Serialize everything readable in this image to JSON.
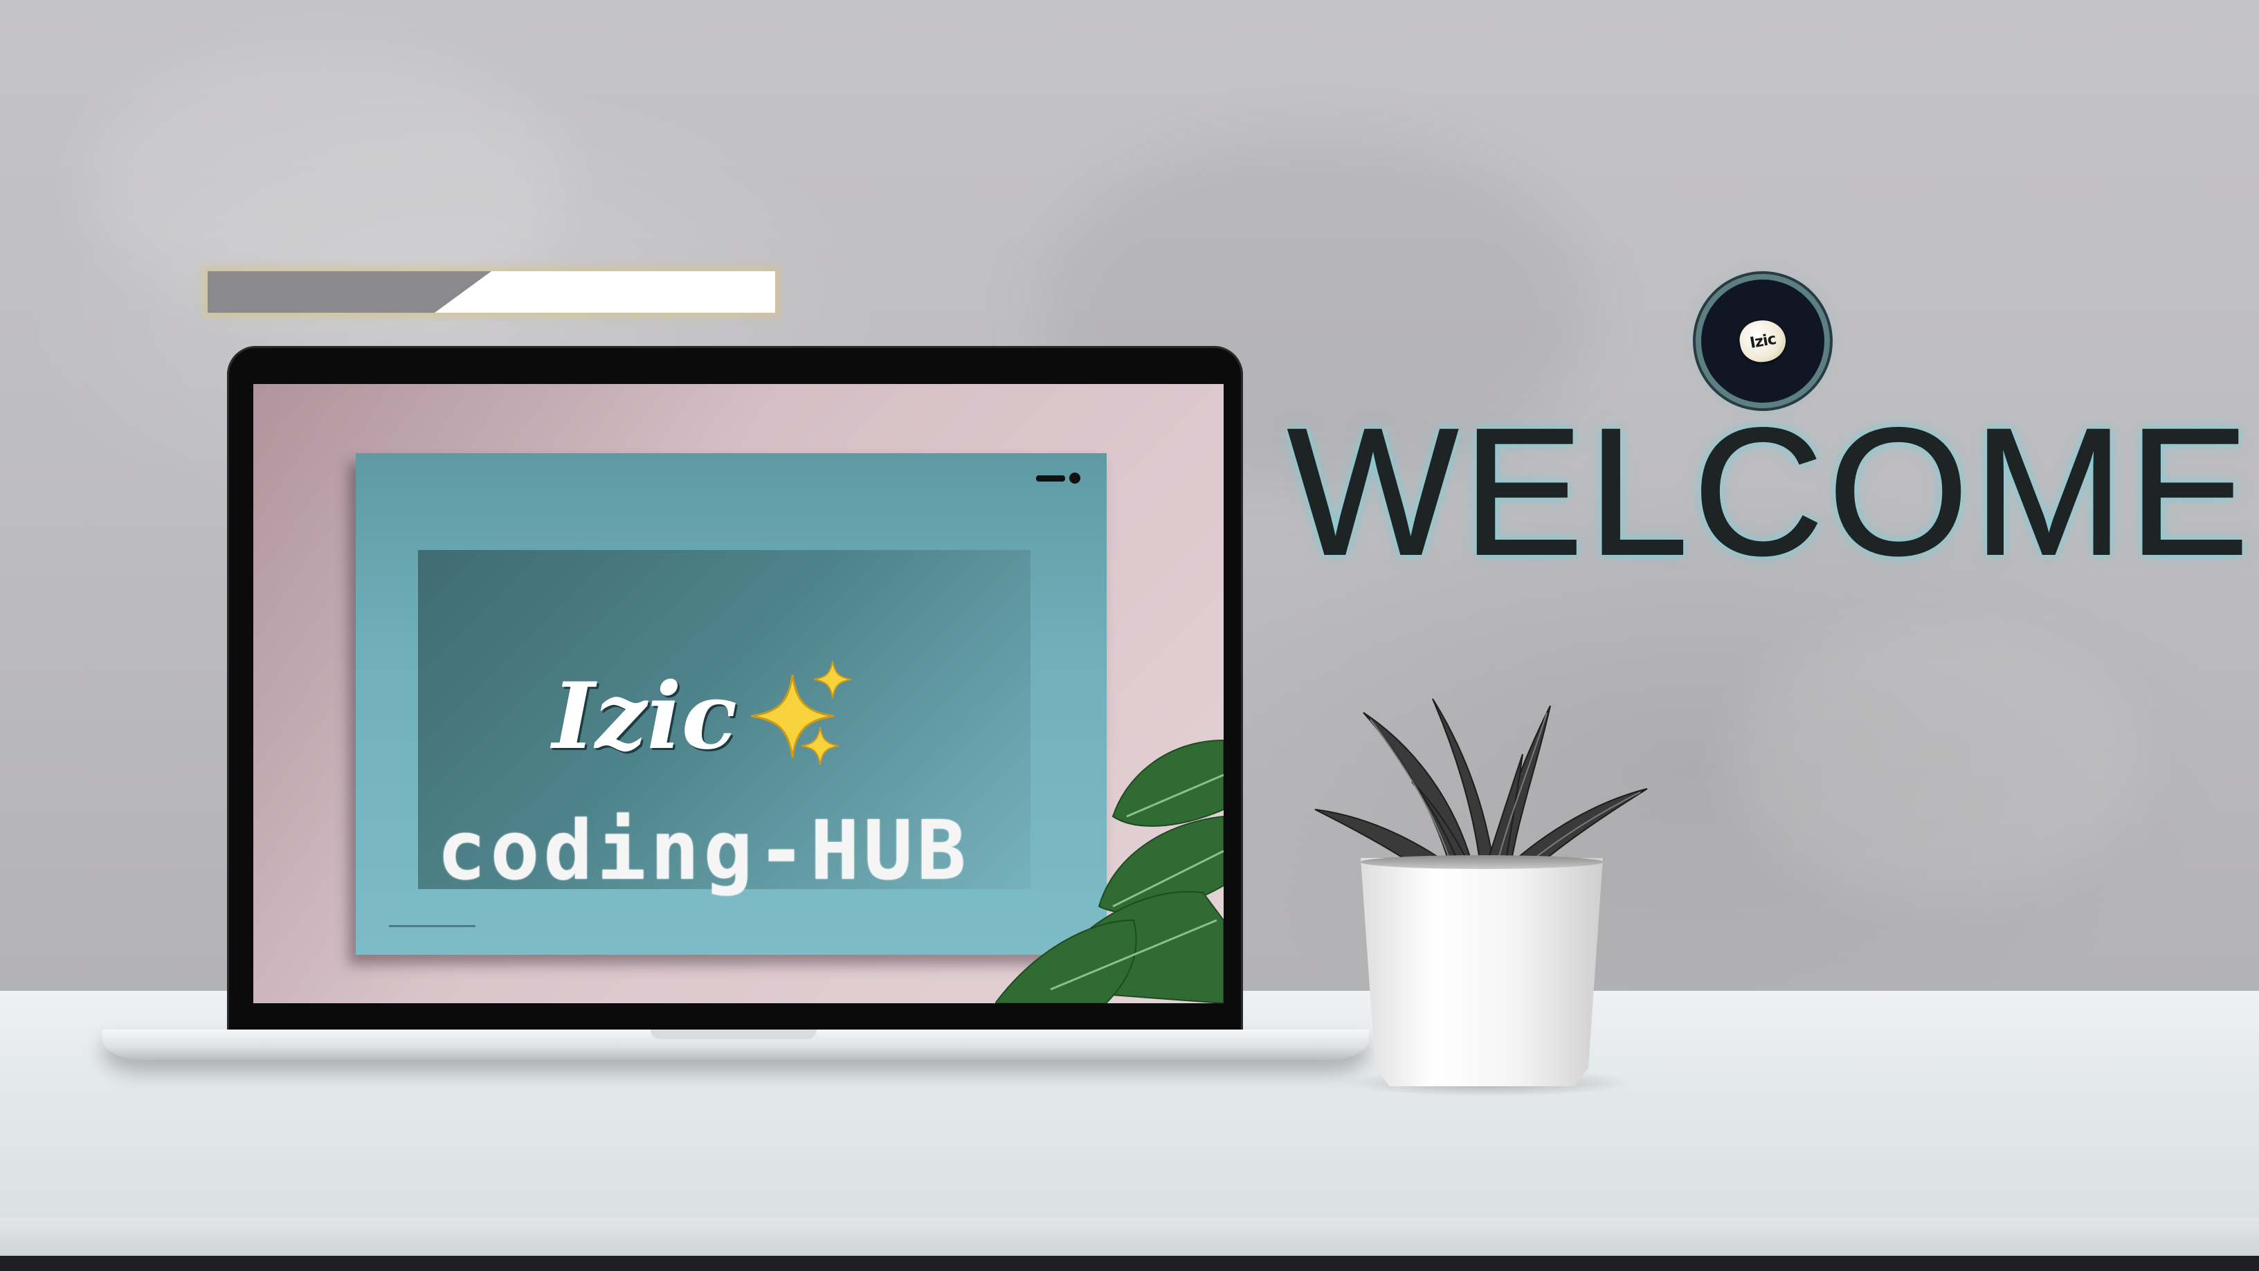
{
  "progress": {
    "value": 0.5
  },
  "laptop": {
    "screen": {
      "brand_title": "Izic",
      "sparkles_icon": "sparkles-icon",
      "brand_subtitle": "coding-HUB"
    }
  },
  "logo": {
    "text": "Izic"
  },
  "welcome": {
    "heading": "WELCOME"
  },
  "colors": {
    "wall": "#bfbec1",
    "desk": "#e6eaeb",
    "screen_teal": "#6fb0ba",
    "screen_pink": "#d8c3c9",
    "welcome_glow": "#7dcdd7",
    "progress_fill": "#8a8a8c",
    "progress_glow": "#d6c48c"
  }
}
